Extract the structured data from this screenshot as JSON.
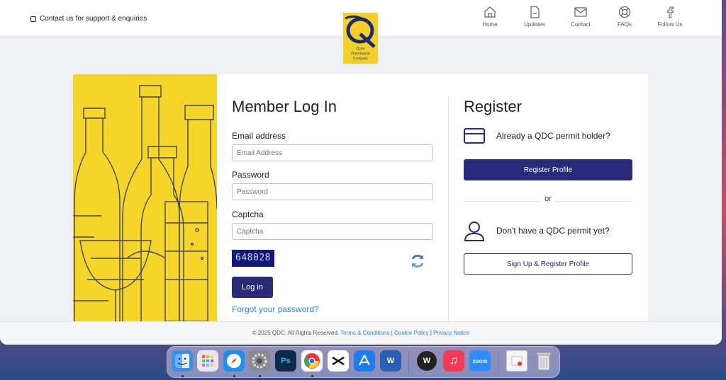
{
  "topbar": {
    "contact_text": "Contact us for support & enquiries",
    "logo_text": [
      "Qatar",
      "Distribution",
      "Company"
    ],
    "nav": [
      {
        "label": "Home",
        "icon": "home-icon"
      },
      {
        "label": "Updates",
        "icon": "document-icon"
      },
      {
        "label": "Contact",
        "icon": "mail-icon"
      },
      {
        "label": "FAQs",
        "icon": "lifebuoy-icon"
      },
      {
        "label": "Follow Us",
        "icon": "facebook-icon"
      }
    ]
  },
  "login": {
    "title": "Member Log In",
    "email_label": "Email address",
    "email_placeholder": "Email Address",
    "password_label": "Password",
    "password_placeholder": "Password",
    "captcha_label": "Captcha",
    "captcha_placeholder": "Captcha",
    "captcha_code": "648028",
    "login_button": "Log in",
    "forgot_link": "Forgot your password?"
  },
  "register": {
    "title": "Register",
    "permit_holder_text": "Already a QDC permit holder?",
    "register_button": "Register Profile",
    "or_text": "or",
    "no_permit_text": "Don't have a QDC permit yet?",
    "signup_button": "Sign Up & Register Profile"
  },
  "footer": {
    "copyright": "© 2025 QDC. All Rights Reserved.",
    "terms": "Terms & Conditions",
    "cookie": "Cookie Policy",
    "privacy": "Privacy Notice",
    "separator": "|"
  },
  "colors": {
    "primary": "#2a2a7a",
    "accent_yellow": "#f6d52b",
    "link": "#2d7fd0"
  },
  "dock": {
    "apps": [
      {
        "name": "Finder",
        "label": "",
        "color": "#3a8ee6",
        "running": true
      },
      {
        "name": "Launchpad",
        "label": "",
        "color": "#e8e8ee",
        "running": false
      },
      {
        "name": "Safari",
        "label": "",
        "color": "#1e8ff0",
        "running": true
      },
      {
        "name": "System Settings",
        "label": "",
        "color": "#8a8a90",
        "running": true
      },
      {
        "name": "Photoshop",
        "label": "Ps",
        "color": "#0c2a4a",
        "running": false
      },
      {
        "name": "Chrome",
        "label": "",
        "color": "#ffffff",
        "running": true
      },
      {
        "name": "CapCut",
        "label": "",
        "color": "#ffffff",
        "running": false
      },
      {
        "name": "App Store",
        "label": "",
        "color": "#1c7cf0",
        "running": false
      },
      {
        "name": "Word",
        "label": "W",
        "color": "#2b5fb5",
        "running": false
      },
      {
        "name": "WordPress",
        "label": "W",
        "color": "#222222",
        "running": false
      },
      {
        "name": "Music",
        "label": "♫",
        "color": "#f43a55",
        "running": false
      },
      {
        "name": "Zoom",
        "label": "zoom",
        "color": "#2d8cff",
        "running": false
      },
      {
        "name": "Recent Document",
        "label": "",
        "color": "#f4f4f4",
        "running": false
      },
      {
        "name": "Trash",
        "label": "",
        "color": "#d8d8dc",
        "running": false
      }
    ]
  }
}
